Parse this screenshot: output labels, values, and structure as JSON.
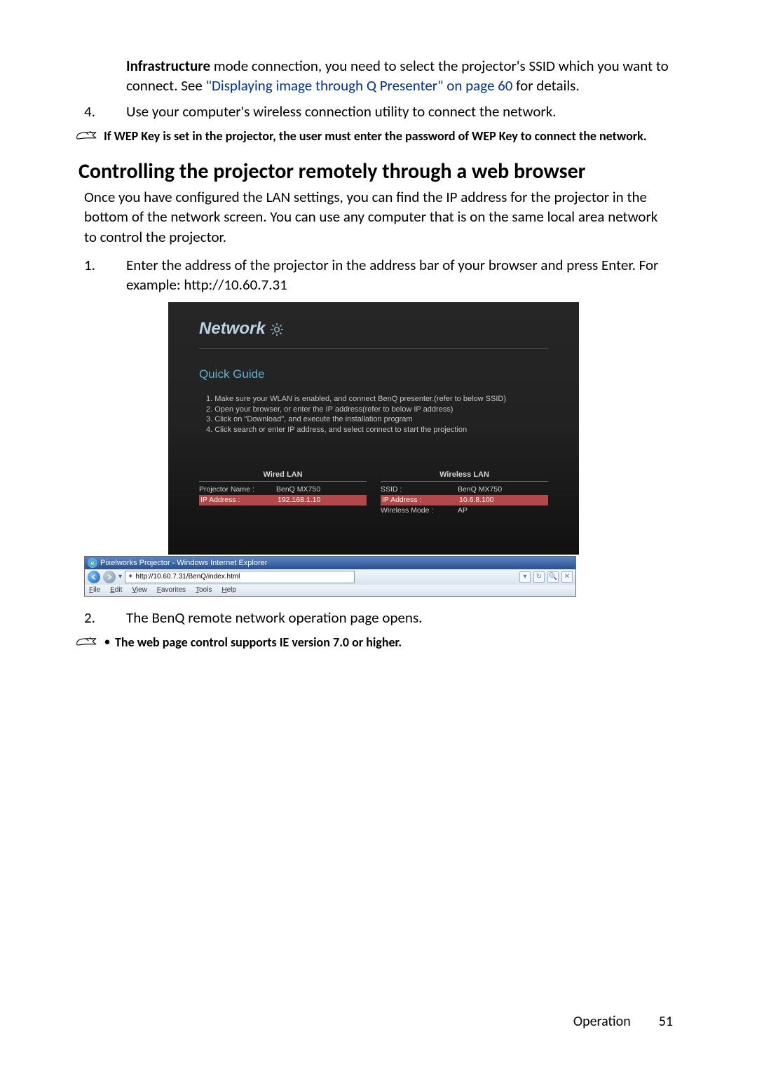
{
  "intro_block": {
    "pre_bold": "Infrastructure",
    "after_bold": " mode connection, you need to select the projector's SSID which you want to connect. See ",
    "link": "\"Displaying image through Q Presenter\" on page 60",
    "after_link": " for details."
  },
  "list_a": {
    "item4_num": "4.",
    "item4_txt": "Use your computer's wireless connection utility to connect the network."
  },
  "note1": "If WEP Key is set in the projector, the user must enter the password of WEP Key to connect the network.",
  "heading": "Controlling the projector remotely through a web browser",
  "intro2": "Once you have configured the LAN settings, you can find the IP address for the projector in the bottom of the network screen. You can use any computer that is on the same local area network to control the projector.",
  "list_b": {
    "item1_num": "1.",
    "item1_txt": "Enter the address of the projector in the address bar of your browser and press Enter. For example: http://10.60.7.31",
    "item2_num": "2.",
    "item2_txt": "The BenQ remote network operation page opens."
  },
  "proj_ui": {
    "title": "Network",
    "quick": "Quick Guide",
    "steps": [
      "1. Make sure your WLAN is enabled, and connect BenQ presenter.(refer to below SSID)",
      "2. Open your browser, or enter the IP address(refer to below IP address)",
      "3. Click on \"Download\", and execute the installation program",
      "4. Click search or enter IP address, and select connect to start the projection"
    ],
    "wired_head": "Wired LAN",
    "wired": {
      "k1": "Projector Name :",
      "v1": "BenQ  MX750",
      "k2": "IP Address :",
      "v2": "192.168.1.10"
    },
    "wireless_head": "Wireless LAN",
    "wireless": {
      "k1": "SSID :",
      "v1": "BenQ  MX750",
      "k2": "IP Address :",
      "v2": "10.6.8.100",
      "k3": "Wireless Mode :",
      "v3": "AP"
    }
  },
  "ie": {
    "title": "Pixelworks Projector - Windows Internet Explorer",
    "url": "http://10.60.7.31/BenQ/index.html",
    "menu": [
      "File",
      "Edit",
      "View",
      "Favorites",
      "Tools",
      "Help"
    ]
  },
  "note2": "The web page control supports IE version 7.0 or higher.",
  "footer_label": "Operation",
  "footer_page": "51"
}
